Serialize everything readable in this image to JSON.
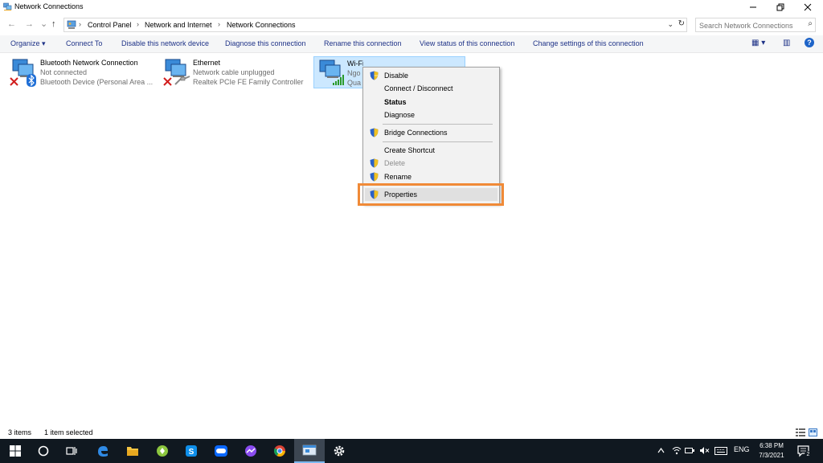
{
  "window": {
    "title": "Network Connections",
    "minimize_icon": "minimize-icon",
    "maximize_icon": "restore-icon",
    "close_icon": "close-icon"
  },
  "address": {
    "back": "←",
    "forward": "→",
    "recent": "⌄",
    "up": "↑",
    "crumbs": [
      "Control Panel",
      "Network and Internet",
      "Network Connections"
    ],
    "separator": "›",
    "dropdown": "⌄",
    "refresh": "↻"
  },
  "search": {
    "placeholder": "Search Network Connections",
    "icon": "⌕"
  },
  "commands": {
    "organize": "Organize ▾",
    "connect_to": "Connect To",
    "disable": "Disable this network device",
    "diagnose": "Diagnose this connection",
    "rename": "Rename this connection",
    "view_status": "View status of this connection",
    "change_settings": "Change settings of this connection",
    "view_options": "▦ ▾",
    "preview_pane": "▥",
    "help": "?"
  },
  "items": [
    {
      "name": "Bluetooth Network Connection",
      "status": "Not connected",
      "device": "Bluetooth Device (Personal Area ..."
    },
    {
      "name": "Ethernet",
      "status": "Network cable unplugged",
      "device": "Realtek PCIe FE Family Controller"
    },
    {
      "name": "Wi-Fi",
      "status": "Ngo",
      "device": "Qua"
    }
  ],
  "context_menu": {
    "disable": "Disable",
    "connect": "Connect / Disconnect",
    "status": "Status",
    "diagnose": "Diagnose",
    "bridge": "Bridge Connections",
    "shortcut": "Create Shortcut",
    "delete": "Delete",
    "rename": "Rename",
    "properties": "Properties"
  },
  "statusbar": {
    "count": "3 items",
    "selected": "1 item selected"
  },
  "taskbar": {
    "tray_lang": "ENG",
    "time": "6:38 PM",
    "date": "7/3/2021",
    "notifications": "2"
  },
  "colors": {
    "accent": "#1e3287",
    "highlight": "#f08a37",
    "selection": "#cce8ff",
    "taskbar": "#101820"
  }
}
